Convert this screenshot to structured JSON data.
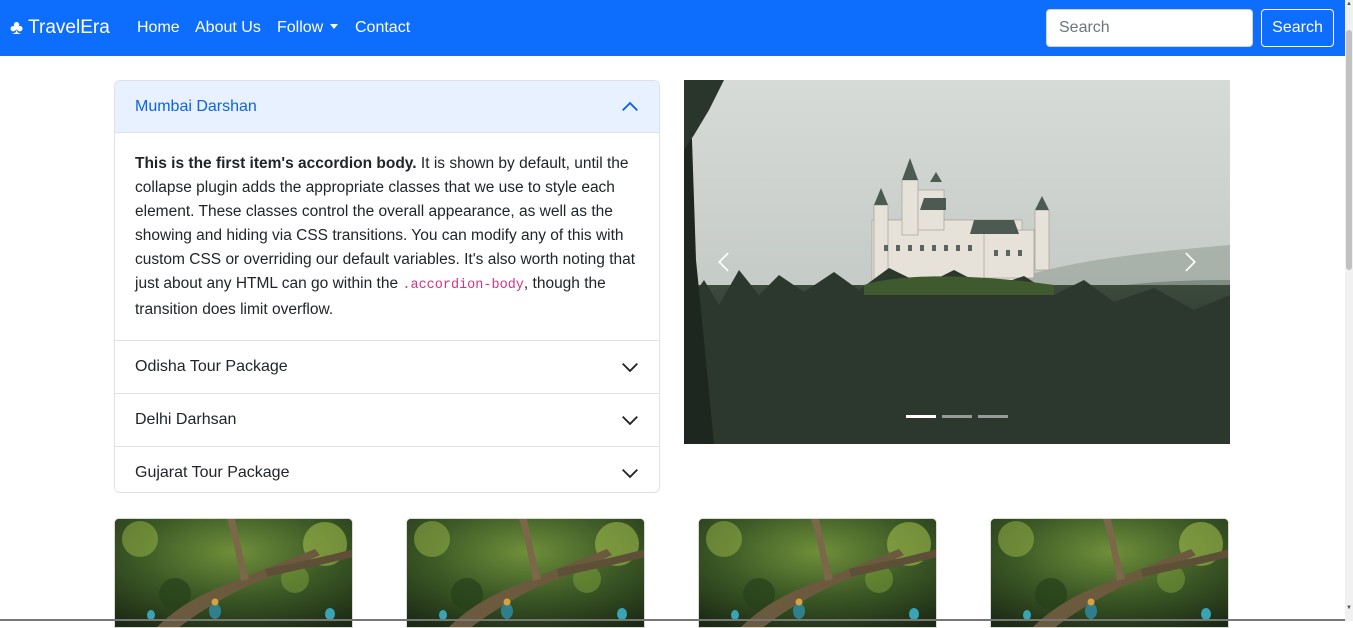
{
  "navbar": {
    "brand_icon": "club-icon",
    "brand": "TravelEra",
    "links": [
      "Home",
      "About Us",
      "Follow",
      "Contact"
    ],
    "search_placeholder": "Search",
    "search_button": "Search",
    "color": "#0d6efd"
  },
  "accordion": {
    "items": [
      {
        "title": "Mumbai Darshan",
        "expanded": true
      },
      {
        "title": "Odisha Tour Package",
        "expanded": false
      },
      {
        "title": "Delhi Darhsan",
        "expanded": false
      },
      {
        "title": "Gujarat Tour Package",
        "expanded": false
      }
    ],
    "body": {
      "strong": "This is the first item's accordion body.",
      "text_1": " It is shown by default, until the collapse plugin adds the appropriate classes that we use to style each element. These classes control the overall appearance, as well as the showing and hiding via CSS transitions. You can modify any of this with custom CSS or overriding our default variables. It's also worth noting that just about any HTML can go within the ",
      "code": ".accordion-body",
      "text_2": ", though the transition does limit overflow."
    }
  },
  "carousel": {
    "slide_count": 3,
    "active_index": 0,
    "prev_icon": "chevron-left-icon",
    "next_icon": "chevron-right-icon"
  },
  "cards": {
    "count": 4
  }
}
